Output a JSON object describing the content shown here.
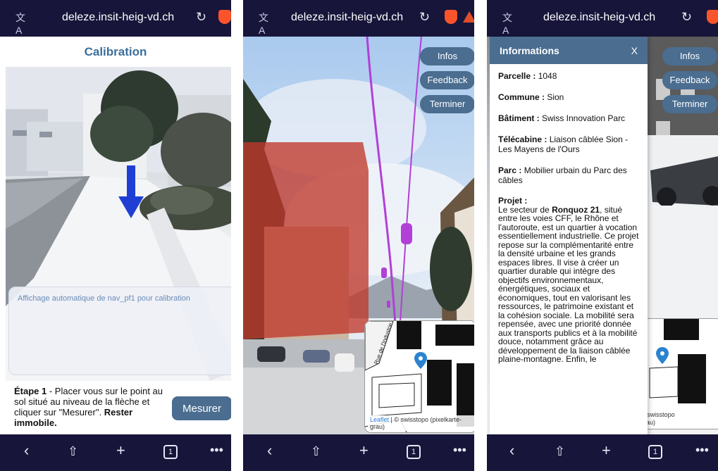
{
  "browser": {
    "url": "deleze.insit-heig-vd.ch",
    "tab_count": "1"
  },
  "calibration": {
    "title": "Calibration",
    "auto_display_text": "Affichage automatique de nav_pf1 pour calibration",
    "step_label": "Étape 1",
    "step_text": " - Placer vous sur le point au sol situé au niveau de la flèche et cliquer sur \"Mesurer\". ",
    "step_bold": "Rester immobile.",
    "measure_button": "Mesurer"
  },
  "ar_view": {
    "buttons": {
      "infos": "Infos",
      "feedback": "Feedback",
      "terminer": "Terminer"
    },
    "map": {
      "street_label": "Rue de l'Industrie",
      "attribution_leaflet": "Leaflet",
      "attribution_rest": " | © swisstopo (pixelkarte-grau)",
      "attribution_partial_1": "© swisstopo",
      "attribution_partial_2": "grau)"
    }
  },
  "info_panel": {
    "title": "Informations",
    "close": "X",
    "rows": [
      {
        "label": "Parcelle :",
        "value": " 1048"
      },
      {
        "label": "Commune :",
        "value": " Sion"
      },
      {
        "label": "Bâtiment :",
        "value": " Swiss Innovation Parc"
      },
      {
        "label": "Télécabine :",
        "value": " Liaison câblée Sion - Les Mayens de l'Ours"
      },
      {
        "label": "Parc :",
        "value": " Mobilier urbain du Parc des câbles"
      }
    ],
    "project": {
      "label": "Projet :",
      "text_1": "Le secteur de ",
      "bold": "Ronquoz 21",
      "text_2": ", situé entre les voies CFF, le Rhône et l'autoroute, est un quartier à vocation essentiellement industrielle. Ce projet repose sur la complémentarité entre la densité urbaine et les grands espaces libres. Il vise à créer un quartier durable qui intègre des objectifs environnementaux, énergétiques, sociaux et économiques, tout en valorisant les ressources, le patrimoine existant et la cohésion sociale. La mobilité sera repensée, avec une priorité donnée aux transports publics et à la mobilité douce, notamment grâce au développement de la liaison câblée plaine-montagne. Enfin, le"
    }
  },
  "colors": {
    "navy_bar": "#17153a",
    "accent_blue": "#4a6d90",
    "title_blue": "#3b6e9c",
    "overlay_red": "#c0392b",
    "cable_purple": "#b23fd8",
    "marker_blue": "#2b83cf"
  },
  "icons": [
    "translate-icon",
    "reload-icon",
    "brave-shield-icon",
    "brave-rewards-icon",
    "back-icon",
    "share-icon",
    "new-tab-plus-icon",
    "tabs-icon",
    "more-icon",
    "arrow-down-icon",
    "map-marker-icon"
  ]
}
